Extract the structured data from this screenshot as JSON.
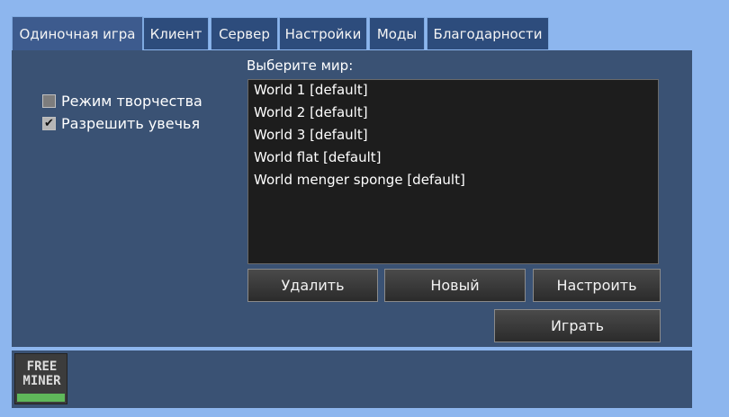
{
  "tabs": [
    {
      "label": "Одиночная игра",
      "active": true
    },
    {
      "label": "Клиент"
    },
    {
      "label": "Сервер"
    },
    {
      "label": "Настройки"
    },
    {
      "label": "Моды"
    },
    {
      "label": "Благодарности"
    }
  ],
  "options": {
    "creative_mode": {
      "label": "Режим творчества",
      "checked": false
    },
    "enable_damage": {
      "label": "Разрешить увечья",
      "checked": true,
      "check_glyph": "✔"
    }
  },
  "worlds": {
    "label": "Выберите мир:",
    "items": [
      "World 1 [default]",
      "World 2 [default]",
      "World 3 [default]",
      "World flat [default]",
      "World menger sponge [default]"
    ]
  },
  "buttons": {
    "delete": "Удалить",
    "new": "Новый",
    "configure": "Настроить",
    "play": "Играть"
  },
  "logo": {
    "line1": "FREE",
    "line2": "MINER"
  },
  "colors": {
    "background": "#8db6ee",
    "panel": "#3a5274",
    "tab": "#2d4c7c",
    "list": "#1d1d1d",
    "logo_accent": "#5fb85a"
  }
}
